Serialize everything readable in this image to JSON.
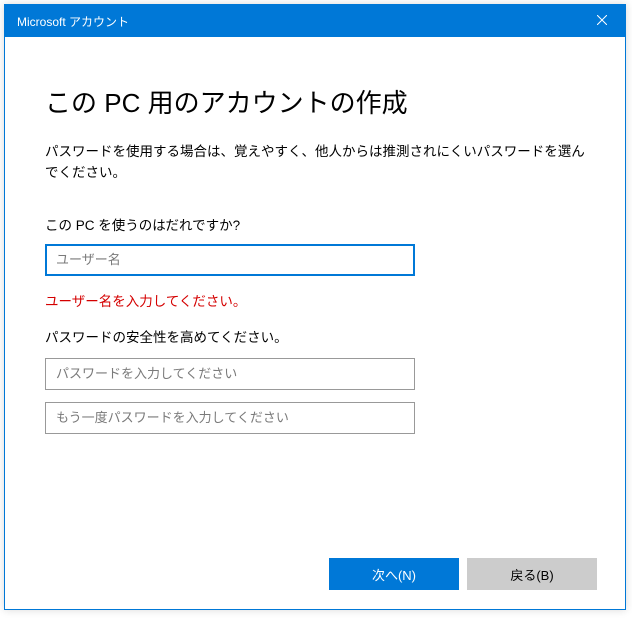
{
  "titlebar": {
    "title": "Microsoft アカウント"
  },
  "main": {
    "heading": "この PC 用のアカウントの作成",
    "description": "パスワードを使用する場合は、覚えやすく、他人からは推測されにくいパスワードを選んでください。",
    "username_label": "この PC を使うのはだれですか?",
    "username_placeholder": "ユーザー名",
    "username_value": "",
    "username_error": "ユーザー名を入力してください。",
    "password_section_label": "パスワードの安全性を高めてください。",
    "password_placeholder": "パスワードを入力してください",
    "password_value": "",
    "password_confirm_placeholder": "もう一度パスワードを入力してください",
    "password_confirm_value": ""
  },
  "footer": {
    "next_label": "次へ(N)",
    "back_label": "戻る(B)"
  }
}
